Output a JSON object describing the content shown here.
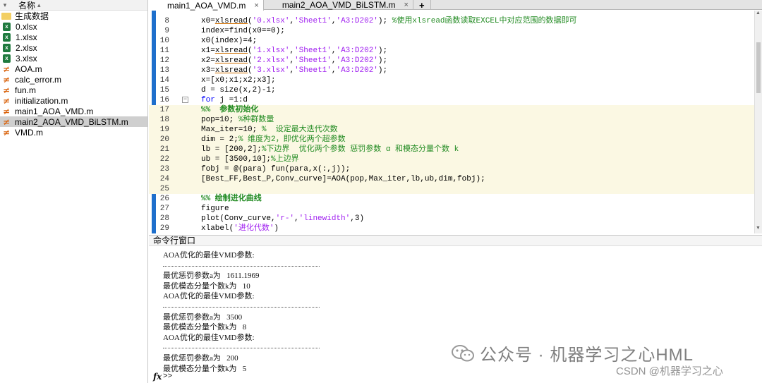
{
  "file_browser": {
    "header": "名称",
    "sort_indicator": "▴",
    "items": [
      {
        "name": "生成数据",
        "type": "folder"
      },
      {
        "name": "0.xlsx",
        "type": "xlsx"
      },
      {
        "name": "1.xlsx",
        "type": "xlsx"
      },
      {
        "name": "2.xlsx",
        "type": "xlsx"
      },
      {
        "name": "3.xlsx",
        "type": "xlsx"
      },
      {
        "name": "AOA.m",
        "type": "m"
      },
      {
        "name": "calc_error.m",
        "type": "m"
      },
      {
        "name": "fun.m",
        "type": "m"
      },
      {
        "name": "initialization.m",
        "type": "m"
      },
      {
        "name": "main1_AOA_VMD.m",
        "type": "m"
      },
      {
        "name": "main2_AOA_VMD_BiLSTM.m",
        "type": "m",
        "selected": true
      },
      {
        "name": "VMD.m",
        "type": "m"
      }
    ]
  },
  "editor": {
    "tabs": [
      {
        "label": "main1_AOA_VMD.m",
        "active": true,
        "close": "×"
      },
      {
        "label": "main2_AOA_VMD_BiLSTM.m",
        "active": false,
        "close": "×"
      }
    ],
    "new_tab_label": "+",
    "lines": [
      {
        "n": "8",
        "segs": [
          [
            "x0=",
            ""
          ],
          [
            "xlsread",
            "ul"
          ],
          [
            "(",
            ""
          ],
          [
            "'0.xlsx'",
            "str"
          ],
          [
            ",",
            ""
          ],
          [
            "'Sheet1'",
            "str"
          ],
          [
            ",",
            ""
          ],
          [
            "'A3:D202'",
            "str"
          ],
          [
            "); ",
            ""
          ],
          [
            "%使用xlsread函数读取EXCEL中对应范围的数据即可",
            "cm"
          ]
        ]
      },
      {
        "n": "9",
        "segs": [
          [
            "index=find(x0==0);",
            ""
          ]
        ]
      },
      {
        "n": "10",
        "segs": [
          [
            "x0(index)=4;",
            ""
          ]
        ]
      },
      {
        "n": "11",
        "segs": [
          [
            "x1=",
            ""
          ],
          [
            "xlsread",
            "ul"
          ],
          [
            "(",
            ""
          ],
          [
            "'1.xlsx'",
            "str"
          ],
          [
            ",",
            ""
          ],
          [
            "'Sheet1'",
            "str"
          ],
          [
            ",",
            ""
          ],
          [
            "'A3:D202'",
            "str"
          ],
          [
            ");",
            ""
          ]
        ]
      },
      {
        "n": "12",
        "segs": [
          [
            "x2=",
            ""
          ],
          [
            "xlsread",
            "ul"
          ],
          [
            "(",
            ""
          ],
          [
            "'2.xlsx'",
            "str"
          ],
          [
            ",",
            ""
          ],
          [
            "'Sheet1'",
            "str"
          ],
          [
            ",",
            ""
          ],
          [
            "'A3:D202'",
            "str"
          ],
          [
            ");",
            ""
          ]
        ]
      },
      {
        "n": "13",
        "segs": [
          [
            "x3=",
            ""
          ],
          [
            "xlsread",
            "ul"
          ],
          [
            "(",
            ""
          ],
          [
            "'3.xlsx'",
            "str"
          ],
          [
            ",",
            ""
          ],
          [
            "'Sheet1'",
            "str"
          ],
          [
            ",",
            ""
          ],
          [
            "'A3:D202'",
            "str"
          ],
          [
            ");",
            ""
          ]
        ]
      },
      {
        "n": "14",
        "segs": [
          [
            "x=[x0;x1;x2;x3];",
            ""
          ]
        ]
      },
      {
        "n": "15",
        "segs": [
          [
            "d = size(x,2)-1;",
            ""
          ]
        ]
      },
      {
        "n": "16",
        "fold": "−",
        "segs": [
          [
            "for",
            "kw"
          ],
          [
            " j =1:d",
            ""
          ]
        ]
      },
      {
        "n": "17",
        "sect": true,
        "segs": [
          [
            "%%  参数初始化",
            "secthd"
          ]
        ]
      },
      {
        "n": "18",
        "sect": true,
        "segs": [
          [
            "pop=10; ",
            ""
          ],
          [
            "%种群数量",
            "cm"
          ]
        ]
      },
      {
        "n": "19",
        "sect": true,
        "segs": [
          [
            "Max_iter=10; ",
            ""
          ],
          [
            "%  设定最大迭代次数",
            "cm"
          ]
        ]
      },
      {
        "n": "20",
        "sect": true,
        "segs": [
          [
            "dim = 2;",
            ""
          ],
          [
            "% 维度为2，即优化两个超参数",
            "cm"
          ]
        ]
      },
      {
        "n": "21",
        "sect": true,
        "segs": [
          [
            "lb = [200,2];",
            ""
          ],
          [
            "%下边界  优化两个参数 惩罚参数 α 和模态分量个数 k",
            "cm"
          ]
        ]
      },
      {
        "n": "22",
        "sect": true,
        "segs": [
          [
            "ub = [3500,10];",
            ""
          ],
          [
            "%上边界",
            "cm"
          ]
        ]
      },
      {
        "n": "23",
        "sect": true,
        "segs": [
          [
            "fobj = @(para) fun(para,x(:,j));",
            ""
          ]
        ]
      },
      {
        "n": "24",
        "sect": true,
        "segs": [
          [
            "[Best_FF,Best_P,Conv_curve]=AOA(pop,Max_iter,lb,ub,dim,fobj);",
            ""
          ]
        ]
      },
      {
        "n": "25",
        "sect": true,
        "segs": []
      },
      {
        "n": "26",
        "segs": [
          [
            "%% 绘制进化曲线",
            "secthd"
          ]
        ]
      },
      {
        "n": "27",
        "segs": [
          [
            "figure",
            ""
          ]
        ]
      },
      {
        "n": "28",
        "segs": [
          [
            "plot(Conv_curve,",
            ""
          ],
          [
            "'r-'",
            "str"
          ],
          [
            ",",
            ""
          ],
          [
            "'linewidth'",
            "str"
          ],
          [
            ",3)",
            ""
          ]
        ]
      },
      {
        "n": "29",
        "segs": [
          [
            "xlabel(",
            ""
          ],
          [
            "'进化代数'",
            "str"
          ],
          [
            ")",
            ""
          ]
        ]
      }
    ]
  },
  "command_window": {
    "title": "命令行窗口",
    "output": [
      {
        "text": "AOA优化的最佳VMD参数:"
      },
      {
        "dash": true
      },
      {
        "text": "最优惩罚参数a为   1611.1969"
      },
      {
        "text": "最优模态分量个数k为   10"
      },
      {
        "text": "AOA优化的最佳VMD参数:"
      },
      {
        "dash": true
      },
      {
        "text": "最优惩罚参数a为   3500"
      },
      {
        "text": "最优模态分量个数k为   8"
      },
      {
        "text": "AOA优化的最佳VMD参数:"
      },
      {
        "dash": true
      },
      {
        "text": "最优惩罚参数a为   200"
      },
      {
        "text": "最优模态分量个数k为   5"
      }
    ],
    "fx_label": "fx",
    "prompt": ">>"
  },
  "watermarks": {
    "wechat": "公众号 · 机器学习之心HML",
    "csdn": "CSDN @机器学习之心"
  },
  "colors": {
    "keyword": "#0000ff",
    "comment": "#228b22",
    "string": "#a020f0",
    "section_bg": "#fbf8e3",
    "gutter_bar": "#1e6fcc",
    "selected_file_bg": "#cfcfcf"
  }
}
